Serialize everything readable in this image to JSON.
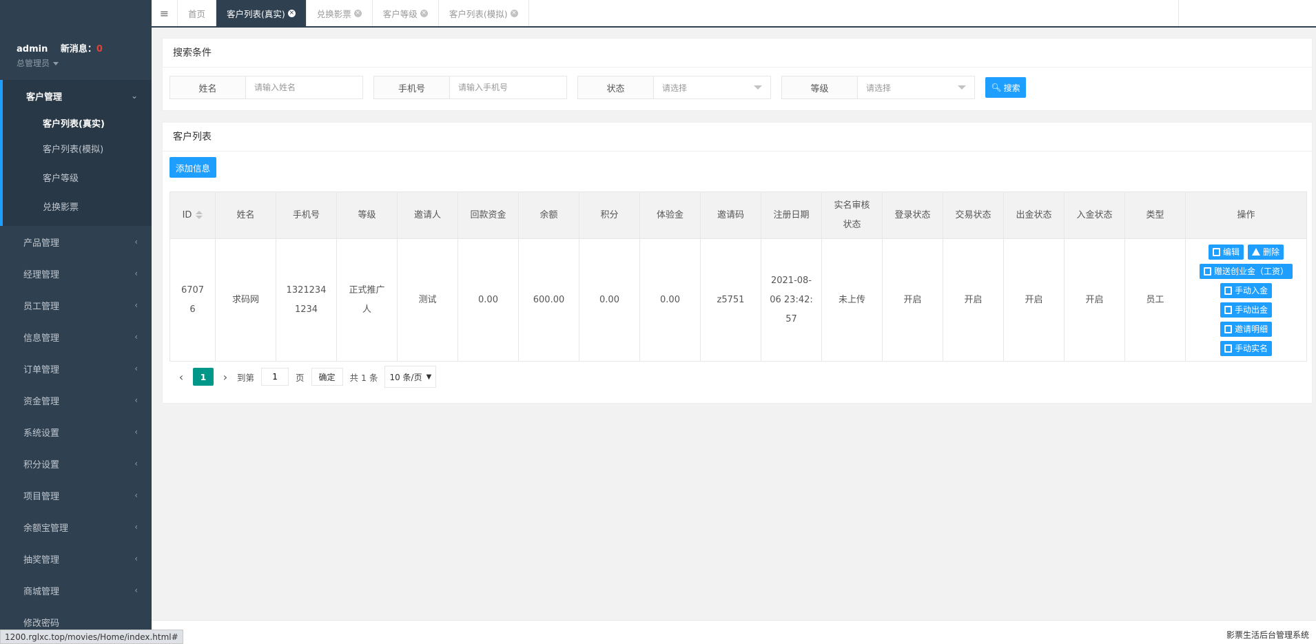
{
  "sidebar": {
    "username": "admin",
    "msg_label": "新消息：",
    "msg_count": "0",
    "role": "总管理员",
    "open_menu": {
      "label": "客户管理",
      "items": [
        {
          "label": "客户列表(真实)"
        },
        {
          "label": "客户列表(模拟)"
        },
        {
          "label": "客户等级"
        },
        {
          "label": "兑换影票"
        }
      ]
    },
    "menus": [
      {
        "label": "产品管理"
      },
      {
        "label": "经理管理"
      },
      {
        "label": "员工管理"
      },
      {
        "label": "信息管理"
      },
      {
        "label": "订单管理"
      },
      {
        "label": "资金管理"
      },
      {
        "label": "系统设置"
      },
      {
        "label": "积分设置"
      },
      {
        "label": "项目管理"
      },
      {
        "label": "余额宝管理"
      },
      {
        "label": "抽奖管理"
      },
      {
        "label": "商城管理"
      },
      {
        "label": "修改密码"
      }
    ]
  },
  "tabs": [
    {
      "label": "首页"
    },
    {
      "label": "客户列表(真实)"
    },
    {
      "label": "兑换影票"
    },
    {
      "label": "客户等级"
    },
    {
      "label": "客户列表(模拟)"
    }
  ],
  "search": {
    "title": "搜索条件",
    "name_label": "姓名",
    "name_placeholder": "请输入姓名",
    "phone_label": "手机号",
    "phone_placeholder": "请输入手机号",
    "status_label": "状态",
    "status_value": "请选择",
    "level_label": "等级",
    "level_value": "请选择",
    "button": "搜索"
  },
  "list": {
    "title": "客户列表",
    "add_button": "添加信息",
    "columns": [
      "ID",
      "姓名",
      "手机号",
      "等级",
      "邀请人",
      "回款资金",
      "余额",
      "积分",
      "体验金",
      "邀请码",
      "注册日期",
      "实名审核状态",
      "登录状态",
      "交易状态",
      "出金状态",
      "入金状态",
      "类型",
      "操作"
    ],
    "rows": [
      {
        "cells": [
          "67076",
          "求码网",
          "13212341234",
          "正式推广人",
          "测试",
          "0.00",
          "600.00",
          "0.00",
          "0.00",
          "z5751",
          "2021-08-06 23:42:57",
          "未上传",
          "开启",
          "开启",
          "开启",
          "开启",
          "员工"
        ],
        "actions": {
          "edit": "编辑",
          "delete": "删除",
          "gift": "赠送创业金（工资）",
          "deposit": "手动入金",
          "withdraw": "手动出金",
          "invite": "邀请明细",
          "verify": "手动实名"
        }
      }
    ]
  },
  "pager": {
    "current": "1",
    "goto_label": "到第",
    "goto_value": "1",
    "page_label": "页",
    "confirm": "确定",
    "total": "共 1 条",
    "page_size": "10 条/页"
  },
  "footer": {
    "system_name": "影票生活后台管理系统",
    "status_url": "1200.rglxc.top/movies/Home/index.html#"
  },
  "colors": {
    "sidebar": "#2f4050",
    "accent": "#1e9fff",
    "pager_active": "#009688",
    "badge": "#e0423c"
  }
}
